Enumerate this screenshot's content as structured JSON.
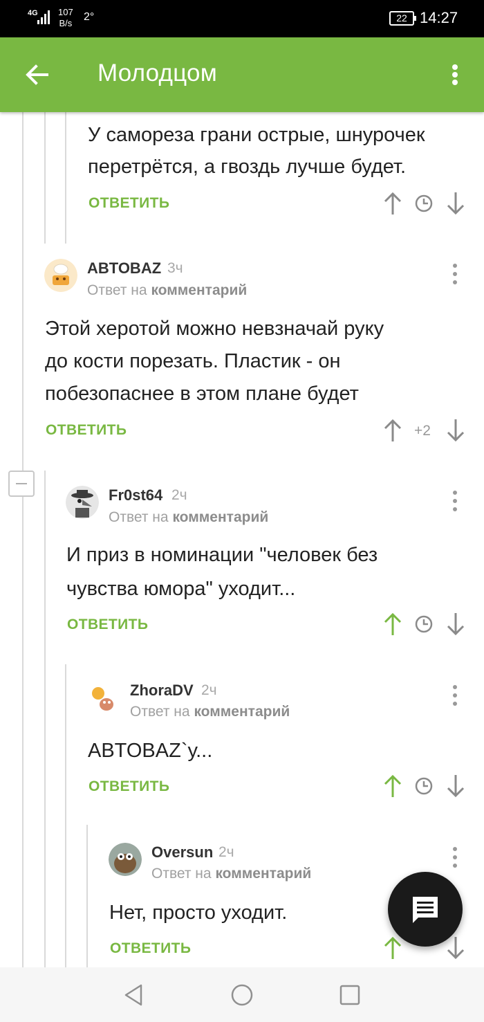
{
  "status_bar": {
    "network": "4G",
    "speed_value": "107",
    "speed_unit": "B/s",
    "temperature": "2°",
    "battery": "22",
    "time": "14:27"
  },
  "app_bar": {
    "title": "Молодцом",
    "back_icon": "arrow-left-icon",
    "menu_icon": "more-vert-icon"
  },
  "comments": [
    {
      "author": "",
      "body": [
        "У самореза грани острые, шнурочек",
        "перетрётся, а гвоздь лучше будет."
      ],
      "reply_label": "ОТВЕТИТЬ"
    },
    {
      "author": "ABTOBAZ",
      "time": "3ч",
      "reply_prefix": "Ответ на",
      "reply_target": "комментарий",
      "body": [
        "Этой херотой можно невзначай руку",
        "до кости порезать. Пластик - он",
        "побезопаснее в этом плане будет"
      ],
      "reply_label": "ОТВЕТИТЬ",
      "score": "+2"
    },
    {
      "author": "Fr0st64",
      "time": "2ч",
      "reply_prefix": "Ответ на",
      "reply_target": "комментарий",
      "body": [
        "И приз в номинации \"человек без",
        "чувства юмора\" уходит..."
      ],
      "reply_label": "ОТВЕТИТЬ"
    },
    {
      "author": "ZhoraDV",
      "time": "2ч",
      "reply_prefix": "Ответ на",
      "reply_target": "комментарий",
      "body": [
        "ABTOBAZ`у..."
      ],
      "reply_label": "ОТВЕТИТЬ"
    },
    {
      "author": "Oversun",
      "time": "2ч",
      "reply_prefix": "Ответ на",
      "reply_target": "комментарий",
      "body": [
        "Нет, просто уходит."
      ],
      "reply_label": "ОТВЕТИТЬ"
    }
  ],
  "colors": {
    "accent": "#79b842",
    "status_bar": "#000000",
    "fab": "#1a1a1a",
    "upvoted": "#79b842",
    "neutral_vote": "#8a8a8a"
  },
  "fab": {
    "icon": "comment-icon"
  },
  "nav_bar": {
    "back_icon": "nav-back-icon",
    "home_icon": "nav-home-icon",
    "recent_icon": "nav-recent-icon"
  }
}
